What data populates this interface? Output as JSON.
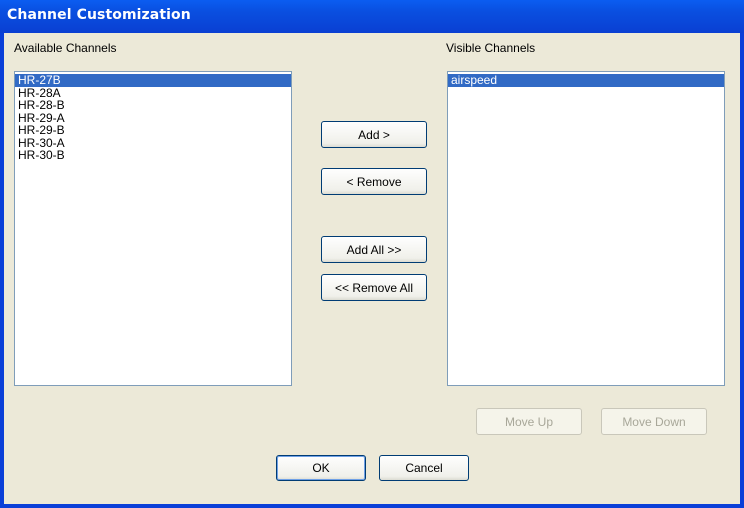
{
  "window": {
    "title": "Channel Customization"
  },
  "available": {
    "label": "Available Channels",
    "items": [
      "HR-27B",
      "HR-28A",
      "HR-28-B",
      "HR-29-A",
      "HR-29-B",
      "HR-30-A",
      "HR-30-B"
    ],
    "selected_index": 0
  },
  "visible": {
    "label": "Visible Channels",
    "items": [
      "airspeed"
    ],
    "selected_index": 0
  },
  "buttons": {
    "add": "Add >",
    "remove": "< Remove",
    "add_all": "Add All >>",
    "remove_all": "<< Remove All",
    "move_up": "Move Up",
    "move_down": "Move Down",
    "ok": "OK",
    "cancel": "Cancel"
  },
  "colors": {
    "selection": "#316ac5",
    "titlebar": "#0a4fe0",
    "dialog_bg": "#ece9d8"
  }
}
